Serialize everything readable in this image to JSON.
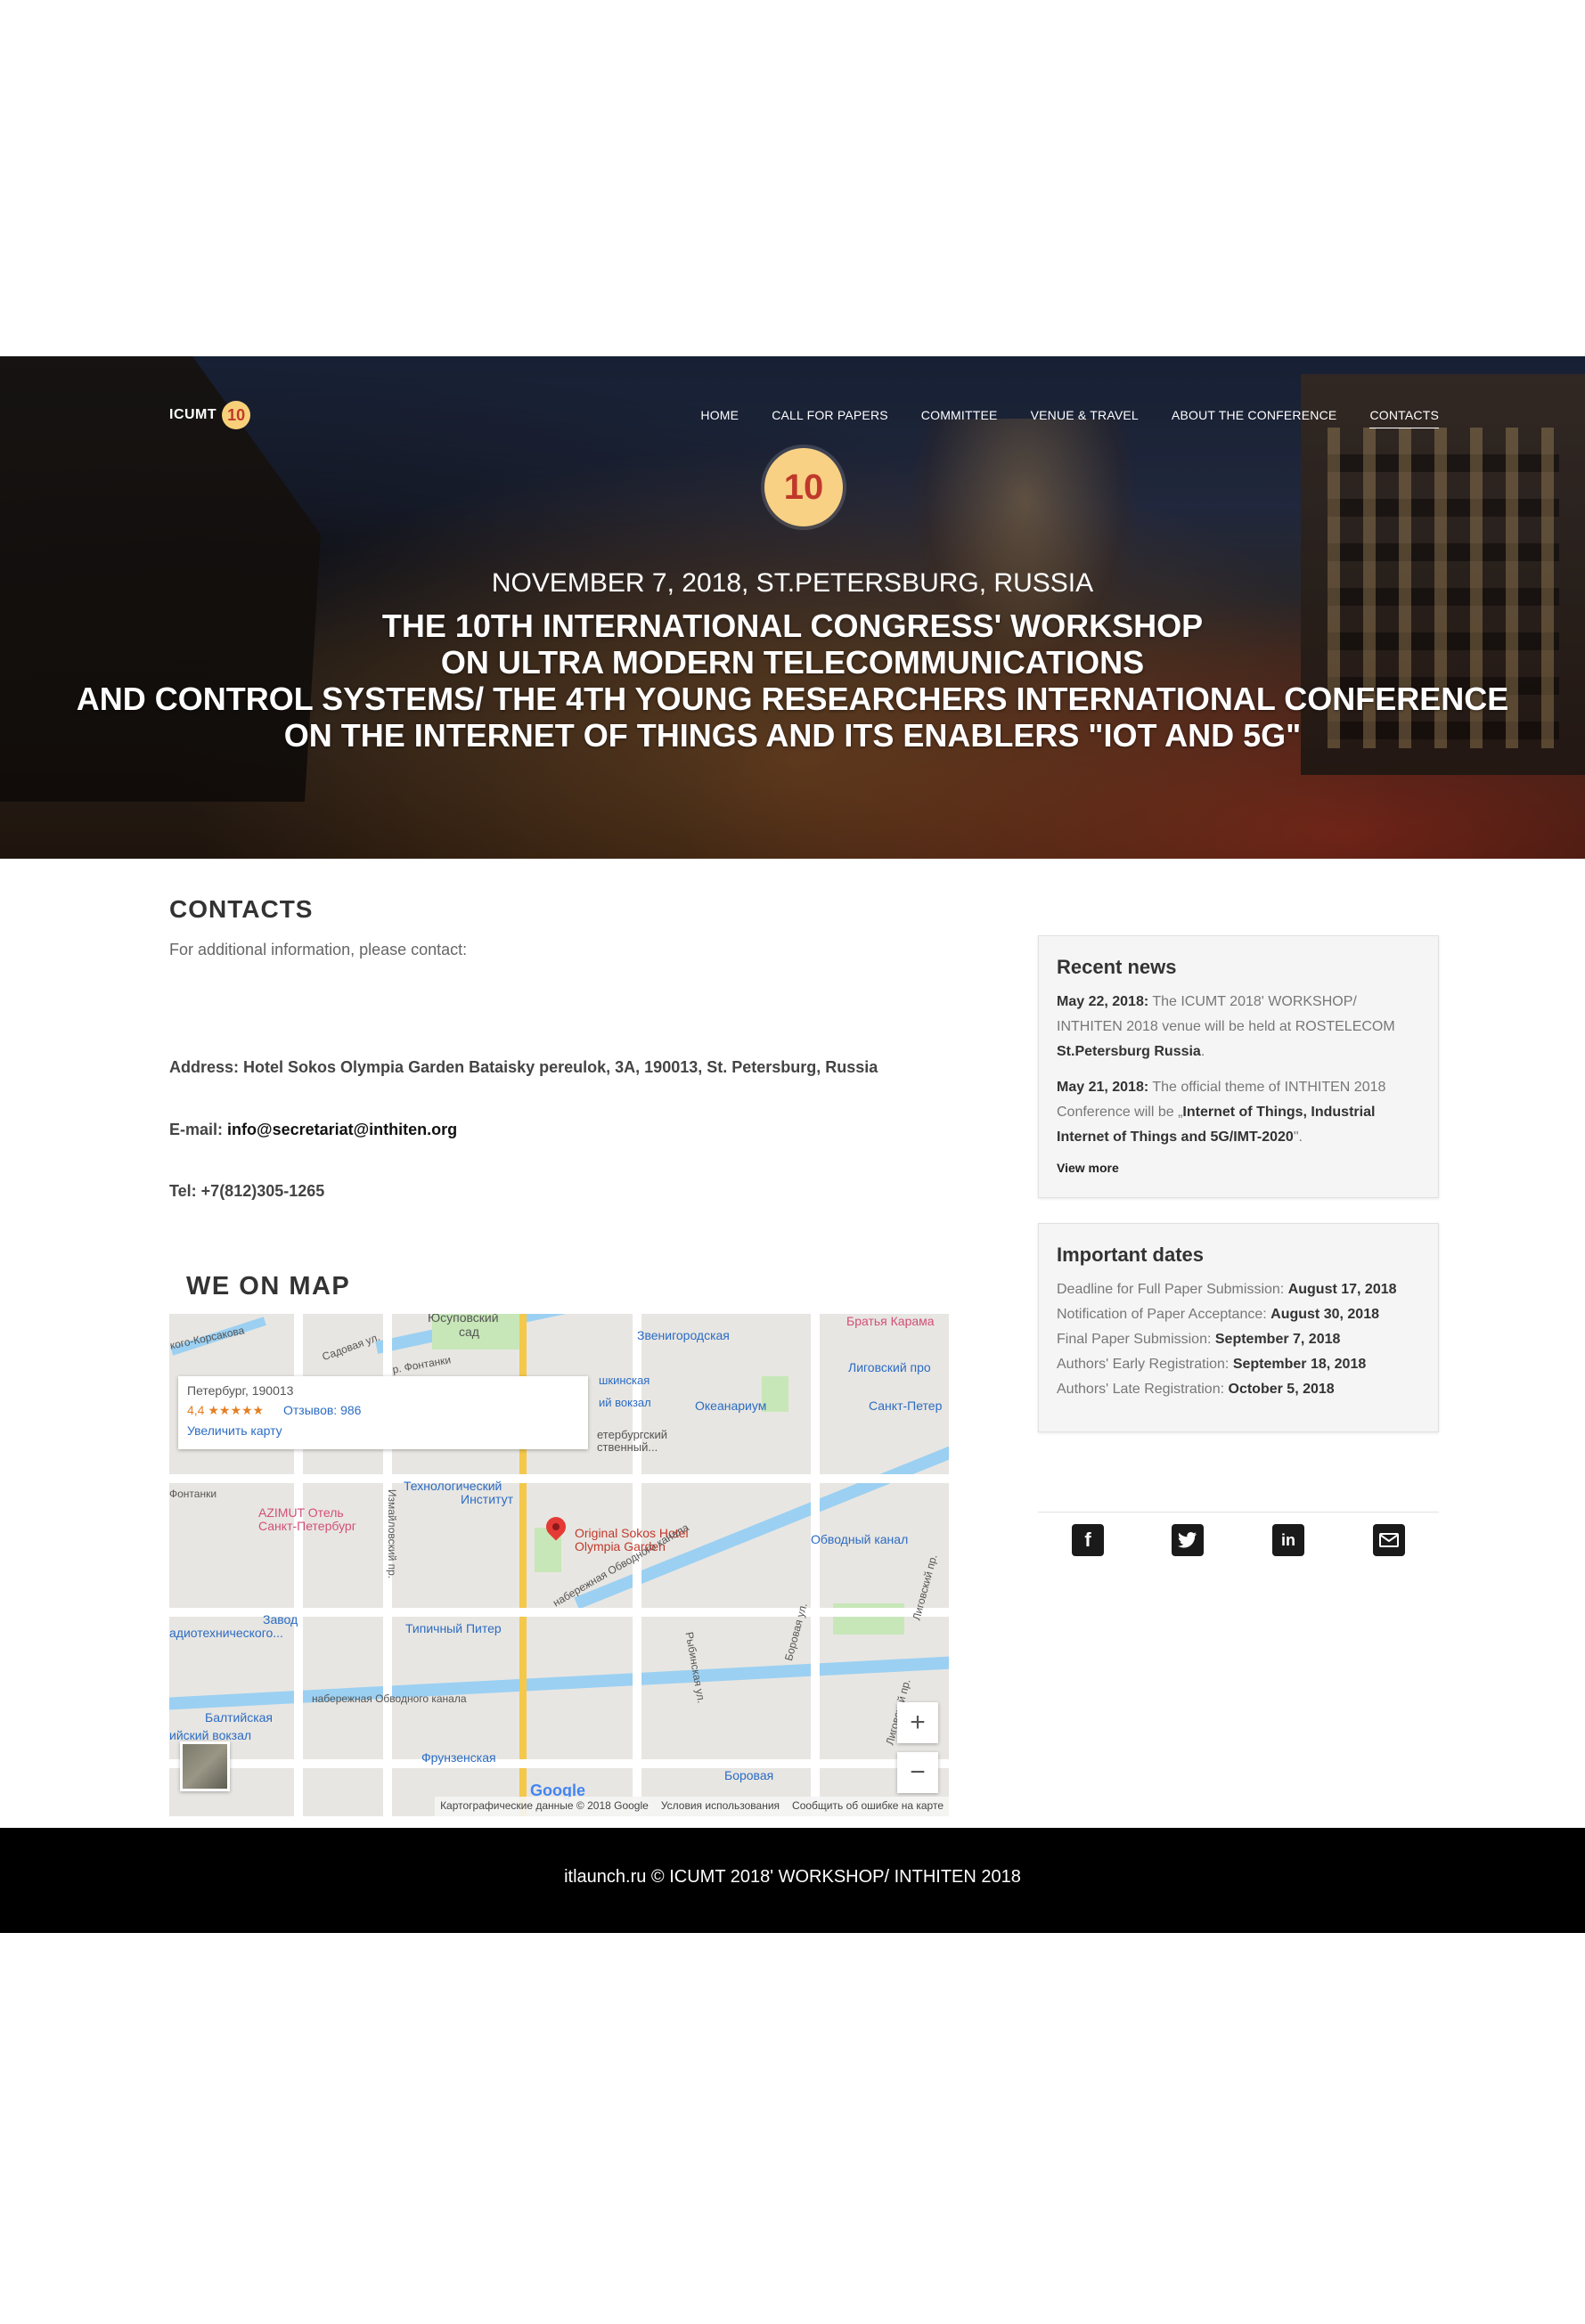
{
  "header": {
    "logo_text": "ICUMT",
    "logo_badge": "10",
    "nav": [
      "HOME",
      "CALL FOR PAPERS",
      "COMMITTEE",
      "VENUE & TRAVEL",
      "ABOUT THE CONFERENCE",
      "CONTACTS"
    ],
    "active_nav": "CONTACTS",
    "badge": "10",
    "date_line": "NOVEMBER 7, 2018, ST.PETERSBURG, RUSSIA",
    "title_lines": [
      "THE 10TH INTERNATIONAL CONGRESS' WORKSHOP",
      "ON ULTRA MODERN TELECOMMUNICATIONS",
      "AND CONTROL SYSTEMS/ THE 4TH YOUNG RESEARCHERS INTERNATIONAL CONFERENCE",
      "ON THE INTERNET OF THINGS AND ITS ENABLERS \"IOT AND 5G\""
    ]
  },
  "contacts": {
    "heading": "CONTACTS",
    "intro": "For additional information, please contact:",
    "address_label": "Address: Hotel Sokos Olympia Garden Bataisky pereulok, 3A, 190013, St. Petersburg, Russia",
    "email_label": "E-mail:",
    "email_value": "info@secretariat@inthiten.org",
    "tel_label": "Tel: +7(812)305-1265"
  },
  "map": {
    "heading": "WE ON MAP",
    "card_address": "Петербург, 190013",
    "card_rating": "4,4 ★★★★★",
    "card_reviews": "Отзывов: 986",
    "card_enlarge": "Увеличить карту",
    "pin_label_1": "Original Sokos Hotel",
    "pin_label_2": "Olympia Garden",
    "labels": {
      "yusupovsky": "Юсуповский",
      "sad": "сад",
      "zvenigorodskaya": "Звенигородская",
      "bratya": "Братья Карама",
      "ligovsky_pro": "Лиговский про",
      "okeanarium": "Океанариум",
      "sankt_peter": "Санкт-Петер",
      "tekhnologichesky": "Технологический",
      "institut": "Институт",
      "azimut_1": "AZIMUT Отель",
      "azimut_2": "Санкт-Петербург",
      "obvodny": "Обводный канал",
      "zavod": "Завод",
      "radiotech": "адиотехнического...",
      "tipichny": "Типичный Питер",
      "baltiyskaya": "Балтийская",
      "baltiysky_vokzal": "ийский вокзал",
      "frunzenskaya": "Фрунзенская",
      "borovaya": "Боровая",
      "sadovaya": "Садовая ул.",
      "korsakova": "кого-Корсакова",
      "pushkinskaya": "шкинская",
      "vitebsky": "ий вокзал",
      "peterburg_gos": "етербургский",
      "gos2": "ственный...",
      "fontanki": "Фонтанки",
      "fontanka2": "р. Фонтанки",
      "izmailovsky": "Измайловский пр.",
      "nab_obvodnogo": "набережная Обводного канала",
      "nab_obv2": "набережная Обводного канала",
      "rybinskaya": "Рыбинская ул.",
      "borovaya_ul": "Боровая ул.",
      "ligovsky_pr": "Лиговский пр.",
      "ligovsky_pr2": "Лиговский пр."
    },
    "zoom_in": "+",
    "zoom_out": "−",
    "google": "Google",
    "footer_data": "Картографические данные © 2018 Google",
    "footer_terms": "Условия использования",
    "footer_report": "Сообщить об ошибке на карте"
  },
  "sidebar": {
    "news_heading": "Recent news",
    "news": [
      {
        "date": "May 22, 2018:",
        "text": "The ICUMT 2018' WORKSHOP/ INTHITEN 2018 venue will be held at ROSTELECOM",
        "bold": "St.Petersburg Russia",
        "end": "."
      },
      {
        "date": "May 21, 2018:",
        "text": "The official theme of INTHITEN 2018 Conference will be „",
        "bold": "Internet of Things, Industrial Internet of Things and 5G/IMT-2020",
        "end": "\"."
      }
    ],
    "view_more": "View more",
    "dates_heading": "Important dates",
    "dates": [
      {
        "label": "Deadline for Full Paper Submission:",
        "value": "August 17, 2018"
      },
      {
        "label": "Notification of Paper Acceptance:",
        "value": "August 30, 2018"
      },
      {
        "label": "Final Paper Submission:",
        "value": "September 7, 2018"
      },
      {
        "label": "Authors' Early Registration:",
        "value": "September 18, 2018"
      },
      {
        "label": "Authors' Late Registration:",
        "value": "October 5, 2018"
      }
    ],
    "social": [
      "facebook-icon",
      "twitter-icon",
      "linkedin-icon",
      "mail-icon"
    ]
  },
  "footer": {
    "text": "itlaunch.ru © ICUMT 2018' WORKSHOP/ INTHITEN 2018"
  }
}
